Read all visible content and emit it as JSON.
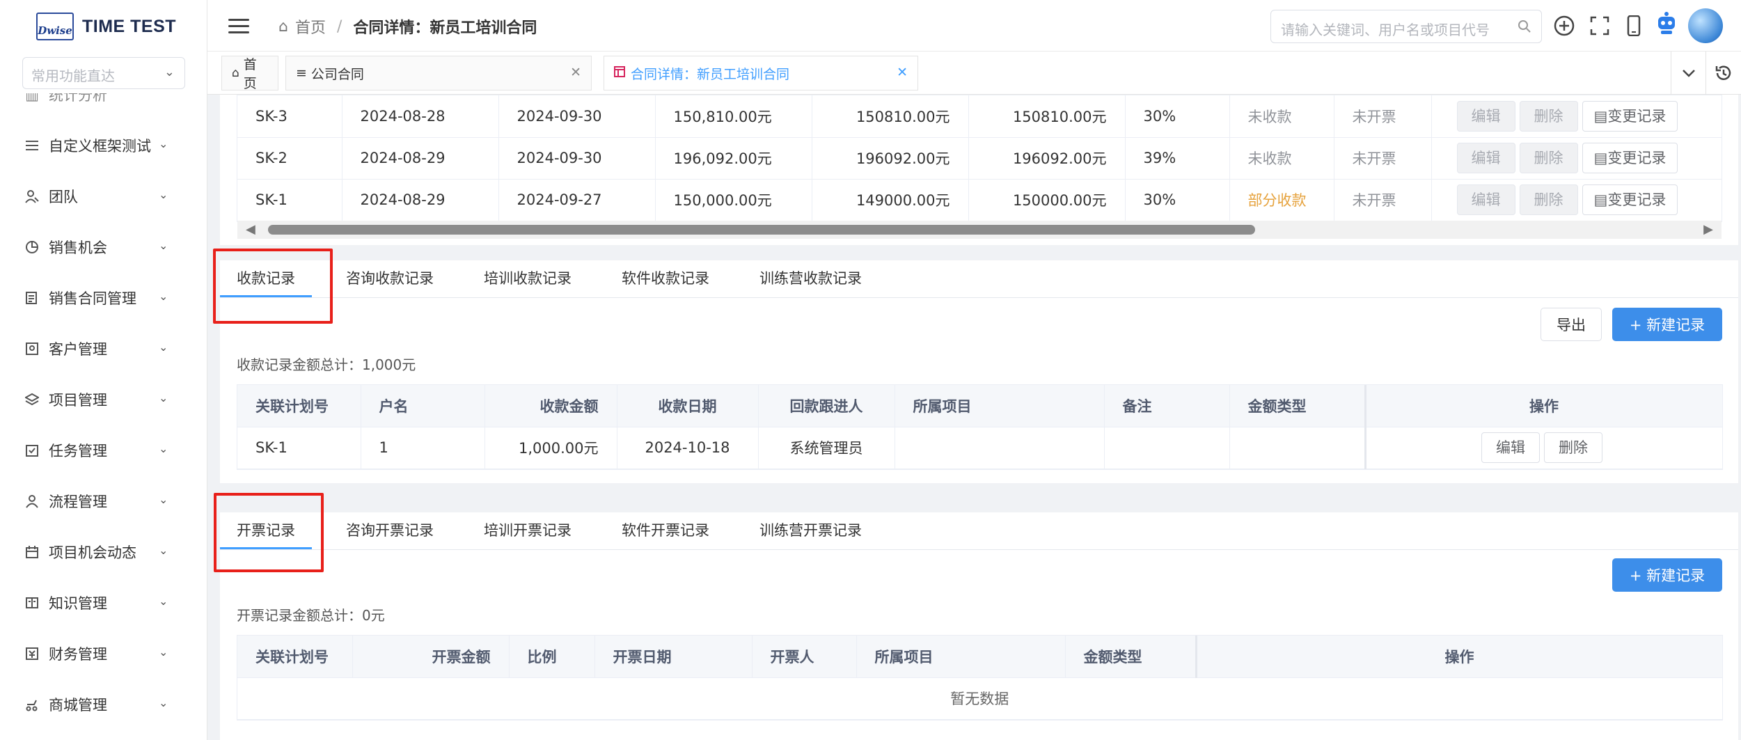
{
  "brand": {
    "logo_mark": "Dwise",
    "name": "TIME TEST"
  },
  "sidebar": {
    "quick_placeholder": "常用功能直达",
    "partial_item": "统计分析",
    "items": [
      {
        "label": "自定义框架测试",
        "icon": "menu-icon"
      },
      {
        "label": "团队",
        "icon": "team-icon"
      },
      {
        "label": "销售机会",
        "icon": "pie-icon"
      },
      {
        "label": "销售合同管理",
        "icon": "contract-icon"
      },
      {
        "label": "客户管理",
        "icon": "customer-icon"
      },
      {
        "label": "项目管理",
        "icon": "layers-icon"
      },
      {
        "label": "任务管理",
        "icon": "task-icon"
      },
      {
        "label": "流程管理",
        "icon": "user-icon"
      },
      {
        "label": "项目机会动态",
        "icon": "calendar-icon"
      },
      {
        "label": "知识管理",
        "icon": "book-icon"
      },
      {
        "label": "财务管理",
        "icon": "finance-icon"
      },
      {
        "label": "商城管理",
        "icon": "shop-icon"
      }
    ]
  },
  "header": {
    "breadcrumb_home": "首页",
    "breadcrumb_sep": "/",
    "breadcrumb_current": "合同详情：新员工培训合同",
    "search_placeholder": "请输入关键词、用户名或项目代号"
  },
  "page_tabs": [
    {
      "label": "首页",
      "icon": "home-icon"
    },
    {
      "label": "公司合同",
      "icon": "filter-icon"
    },
    {
      "label": "合同详情：新员工培训合同",
      "icon": "table-icon"
    }
  ],
  "plan_table": {
    "rows": [
      {
        "code": "SK-3",
        "start": "2024-08-28",
        "end": "2024-09-30",
        "amount": "150,810.00元",
        "v1": "150810.00元",
        "v2": "150810.00元",
        "ratio": "30%",
        "pay_status": "未收款",
        "invoice_status": "未开票"
      },
      {
        "code": "SK-2",
        "start": "2024-08-29",
        "end": "2024-09-30",
        "amount": "196,092.00元",
        "v1": "196092.00元",
        "v2": "196092.00元",
        "ratio": "39%",
        "pay_status": "未收款",
        "invoice_status": "未开票"
      },
      {
        "code": "SK-1",
        "start": "2024-08-29",
        "end": "2024-09-27",
        "amount": "150,000.00元",
        "v1": "149000.00元",
        "v2": "150000.00元",
        "ratio": "30%",
        "pay_status": "部分收款",
        "invoice_status": "未开票"
      }
    ],
    "actions": {
      "edit": "编辑",
      "delete": "删除",
      "history": "变更记录"
    }
  },
  "receipt": {
    "tabs": [
      "收款记录",
      "咨询收款记录",
      "培训收款记录",
      "软件收款记录",
      "训练营收款记录"
    ],
    "export": "导出",
    "new": "+ 新建记录",
    "total": "收款记录金额总计：1,000元",
    "headers": [
      "关联计划号",
      "户名",
      "收款金额",
      "收款日期",
      "回款跟进人",
      "所属项目",
      "备注",
      "金额类型",
      "操作"
    ],
    "rows": [
      {
        "plan": "SK-1",
        "name": "1",
        "amount": "1,000.00元",
        "date": "2024-10-18",
        "follower": "系统管理员",
        "project": "",
        "remark": "",
        "type": ""
      }
    ],
    "actions": {
      "edit": "编辑",
      "delete": "删除"
    }
  },
  "invoice": {
    "tabs": [
      "开票记录",
      "咨询开票记录",
      "培训开票记录",
      "软件开票记录",
      "训练营开票记录"
    ],
    "new": "+ 新建记录",
    "total": "开票记录金额总计：0元",
    "headers": [
      "关联计划号",
      "开票金额",
      "比例",
      "开票日期",
      "开票人",
      "所属项目",
      "金额类型",
      "操作"
    ],
    "empty": "暂无数据"
  },
  "colors": {
    "primary": "#3d8eea",
    "highlight_box": "#e8201a",
    "warning": "#e6a23c"
  }
}
